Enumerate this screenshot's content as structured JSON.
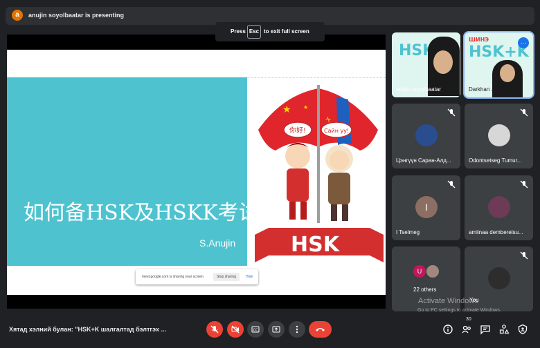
{
  "presenter": {
    "avatar_letter": "a",
    "text": "anujin soyolbaatar is presenting"
  },
  "fullscreen_toast": {
    "press": "Press",
    "key": "Esc",
    "suffix": "to exit full screen"
  },
  "slide": {
    "title": "如何备HSK及HSKK考试",
    "author": "S.Anujin",
    "flag_bubble_left": "你好!",
    "flag_bubble_right": "Сайн уу!",
    "banner": "HSK"
  },
  "share_notice": {
    "text": "meet.google.com is sharing your screen.",
    "stop": "Stop sharing",
    "hide": "Hide"
  },
  "participants": [
    {
      "name": "anujin soyolbaatar"
    },
    {
      "name": "Darkhan ..."
    },
    {
      "name": "Цэнгүүн Саран-Алд..."
    },
    {
      "name": "Odontsetseg Tumur..."
    },
    {
      "name": "I Tselmeg",
      "initial": "I"
    },
    {
      "name": "amiinaa demberelsu..."
    },
    {
      "name": "22 others",
      "initial": "U"
    },
    {
      "name": "You"
    }
  ],
  "tile_slide_text": {
    "hsk": "HSK+K",
    "shine": "ШИНЭ"
  },
  "bottom": {
    "meeting_title": "Хятад хэлний булан: \"HSK+K шалгалтад бэлтгэх ...",
    "people_count": "30"
  },
  "watermark": {
    "line1": "Activate Windows",
    "line2": "Go to PC settings to activate Windows."
  },
  "colors": {
    "mic_off": "#ea4335",
    "slide_band": "#4ec3cf",
    "presenter_avatar": "#e37400"
  }
}
